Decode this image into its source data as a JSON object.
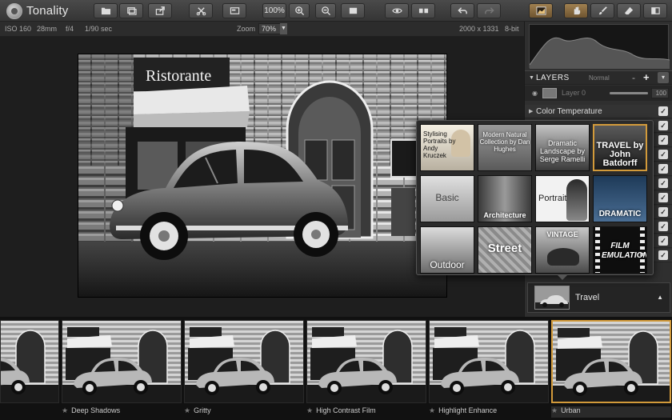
{
  "app": {
    "title": "Tonality"
  },
  "toolbar": {
    "zoom_value": "100%",
    "icons": [
      "open-folder-icon",
      "batch-icon",
      "export-icon",
      "crop-tools-icon",
      "compare-icon",
      "zoom-in-icon",
      "zoom-out-icon",
      "fit-screen-icon",
      "preview-eye-icon",
      "split-view-icon",
      "undo-icon",
      "redo-icon",
      "histogram-toggle-icon",
      "hand-tool-icon",
      "brush-tool-icon",
      "eraser-tool-icon",
      "gradient-tool-icon"
    ]
  },
  "infobar": {
    "iso": "ISO 160",
    "focal": "28mm",
    "aperture": "f/4",
    "shutter": "1/90 sec",
    "zoom_label": "Zoom",
    "zoom_value": "70%",
    "dimensions": "2000 x 1331",
    "bitdepth": "8-bit"
  },
  "layers": {
    "title": "LAYERS",
    "blend_mode": "Normal",
    "minus": "-",
    "plus": "+",
    "layer_name": "Layer 0",
    "opacity": "100",
    "opacity_fraction": 1.0
  },
  "adjustments": [
    {
      "label": "Color Temperature",
      "enabled": true
    }
  ],
  "popup": {
    "presets": [
      {
        "caption": "Stylising Portraits by Andy Kruczek",
        "style": "portrait"
      },
      {
        "caption": "Modern Natural Collection by Dan Hughes",
        "style": "collection"
      },
      {
        "caption": "Dramatic Landscape by Serge Ramelli",
        "style": "landscape"
      },
      {
        "caption": "TRAVEL by John Batdorff",
        "style": "travel",
        "selected": true
      },
      {
        "caption": "Basic",
        "style": "basic"
      },
      {
        "caption": "Architecture",
        "style": "architecture"
      },
      {
        "caption": "Portrait",
        "style": "portrait2"
      },
      {
        "caption": "DRAMATIC",
        "style": "dramatic"
      },
      {
        "caption": "Outdoor",
        "style": "outdoor"
      },
      {
        "caption": "Street",
        "style": "street"
      },
      {
        "caption": "VINTAGE",
        "style": "vintage"
      },
      {
        "caption": "FILM EMULATION",
        "style": "film"
      }
    ]
  },
  "preset_bar": {
    "name": "Travel"
  },
  "filmstrip": {
    "items": [
      {
        "label": "Deep Shadows"
      },
      {
        "label": "Gritty"
      },
      {
        "label": "High Contrast Film"
      },
      {
        "label": "Highlight Enhance"
      },
      {
        "label": "Urban",
        "selected": true
      }
    ]
  },
  "photo": {
    "sign_text": "Ristorante"
  }
}
